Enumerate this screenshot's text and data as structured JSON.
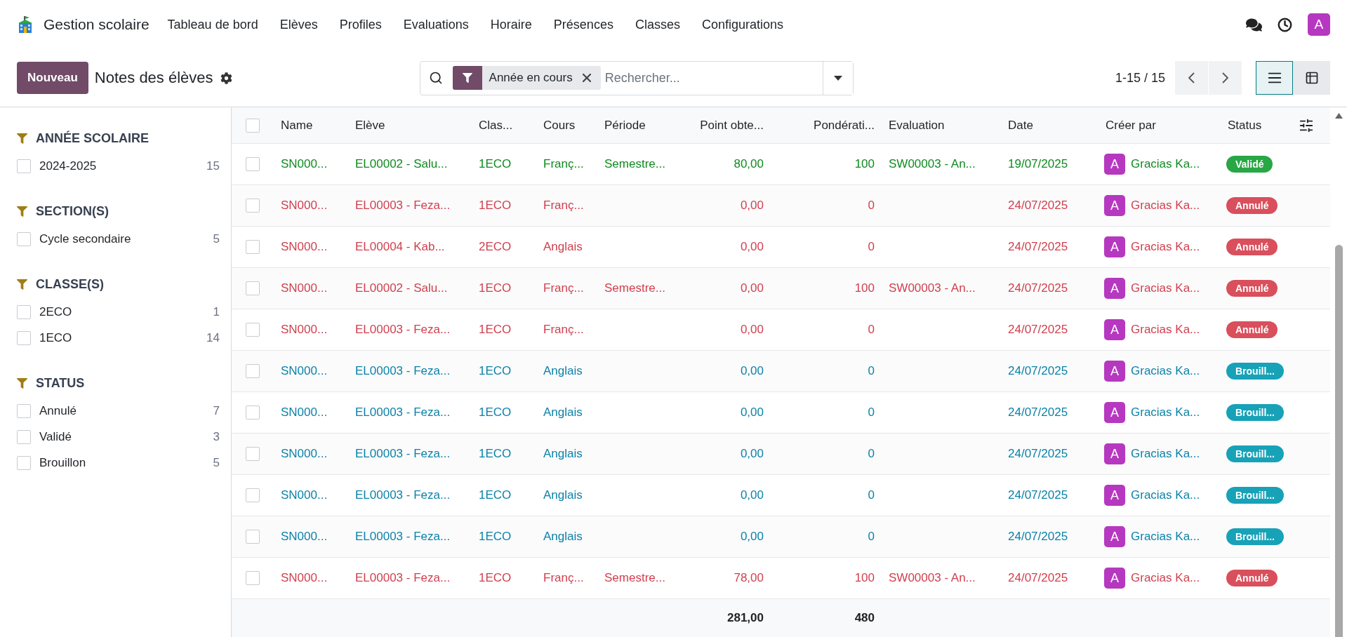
{
  "app": {
    "title": "Gestion scolaire",
    "avatar": "A"
  },
  "menu": [
    "Tableau de bord",
    "Elèves",
    "Profiles",
    "Evaluations",
    "Horaire",
    "Présences",
    "Classes",
    "Configurations"
  ],
  "control_panel": {
    "new_button": "Nouveau",
    "title": "Notes des élèves",
    "facet": "Année en cours",
    "search_placeholder": "Rechercher...",
    "pager": "1-15 / 15",
    "views": [
      {
        "kind": "list",
        "selected": true
      },
      {
        "kind": "pivot",
        "selected": false
      }
    ]
  },
  "sidebar": [
    {
      "title": "ANNÉE SCOLAIRE",
      "items": [
        {
          "label": "2024-2025",
          "count": "15",
          "checked": false
        }
      ]
    },
    {
      "title": "SECTION(S)",
      "items": [
        {
          "label": "Cycle secondaire",
          "count": "5",
          "checked": false
        }
      ]
    },
    {
      "title": "CLASSE(S)",
      "items": [
        {
          "label": "2ECO",
          "count": "1",
          "checked": false
        },
        {
          "label": "1ECO",
          "count": "14",
          "checked": false
        }
      ]
    },
    {
      "title": "STATUS",
      "items": [
        {
          "label": "Annulé",
          "count": "7",
          "checked": false
        },
        {
          "label": "Validé",
          "count": "3",
          "checked": false
        },
        {
          "label": "Brouillon",
          "count": "5",
          "checked": false
        }
      ]
    }
  ],
  "table": {
    "select_all": {
      "checked": false
    },
    "columns": [
      {
        "label": "Name",
        "kind": "text"
      },
      {
        "label": "Elève",
        "kind": "text"
      },
      {
        "label": "Clas...",
        "kind": "text"
      },
      {
        "label": "Cours",
        "kind": "text"
      },
      {
        "label": "Période",
        "kind": "text"
      },
      {
        "label": "Point obte...",
        "kind": "number",
        "total": "281,00"
      },
      {
        "label": "Pondérati...",
        "kind": "number",
        "total": "480"
      },
      {
        "label": "Evaluation",
        "kind": "text"
      },
      {
        "label": "Date",
        "kind": "text"
      },
      {
        "label": "Créer par",
        "kind": "user"
      },
      {
        "label": "Status",
        "kind": "status"
      }
    ],
    "rows": [
      {
        "checked": false,
        "cells": [
          "SN000...",
          "EL00002 - Salu...",
          "1ECO",
          "Franç...",
          "Semestre...",
          "80,00",
          "100",
          "SW00003 - An...",
          "19/07/2025",
          "Gracias Ka..."
        ],
        "avatar": "A",
        "status": {
          "label": "Validé",
          "kind": "validated"
        }
      },
      {
        "checked": false,
        "cells": [
          "SN000...",
          "EL00003 - Feza...",
          "1ECO",
          "Franç...",
          null,
          "0,00",
          "0",
          null,
          "24/07/2025",
          "Gracias Ka..."
        ],
        "avatar": "A",
        "status": {
          "label": "Annulé",
          "kind": "cancelled"
        }
      },
      {
        "checked": false,
        "cells": [
          "SN000...",
          "EL00004 - Kab...",
          "2ECO",
          "Anglais",
          null,
          "0,00",
          "0",
          null,
          "24/07/2025",
          "Gracias Ka..."
        ],
        "avatar": "A",
        "status": {
          "label": "Annulé",
          "kind": "cancelled"
        }
      },
      {
        "checked": false,
        "cells": [
          "SN000...",
          "EL00002 - Salu...",
          "1ECO",
          "Franç...",
          "Semestre...",
          "0,00",
          "100",
          "SW00003 - An...",
          "24/07/2025",
          "Gracias Ka..."
        ],
        "avatar": "A",
        "status": {
          "label": "Annulé",
          "kind": "cancelled"
        }
      },
      {
        "checked": false,
        "cells": [
          "SN000...",
          "EL00003 - Feza...",
          "1ECO",
          "Franç...",
          null,
          "0,00",
          "0",
          null,
          "24/07/2025",
          "Gracias Ka..."
        ],
        "avatar": "A",
        "status": {
          "label": "Annulé",
          "kind": "cancelled"
        }
      },
      {
        "checked": false,
        "cells": [
          "SN000...",
          "EL00003 - Feza...",
          "1ECO",
          "Anglais",
          null,
          "0,00",
          "0",
          null,
          "24/07/2025",
          "Gracias Ka..."
        ],
        "avatar": "A",
        "status": {
          "label": "Brouill...",
          "kind": "draft"
        }
      },
      {
        "checked": false,
        "cells": [
          "SN000...",
          "EL00003 - Feza...",
          "1ECO",
          "Anglais",
          null,
          "0,00",
          "0",
          null,
          "24/07/2025",
          "Gracias Ka..."
        ],
        "avatar": "A",
        "status": {
          "label": "Brouill...",
          "kind": "draft"
        }
      },
      {
        "checked": false,
        "cells": [
          "SN000...",
          "EL00003 - Feza...",
          "1ECO",
          "Anglais",
          null,
          "0,00",
          "0",
          null,
          "24/07/2025",
          "Gracias Ka..."
        ],
        "avatar": "A",
        "status": {
          "label": "Brouill...",
          "kind": "draft"
        }
      },
      {
        "checked": false,
        "cells": [
          "SN000...",
          "EL00003 - Feza...",
          "1ECO",
          "Anglais",
          null,
          "0,00",
          "0",
          null,
          "24/07/2025",
          "Gracias Ka..."
        ],
        "avatar": "A",
        "status": {
          "label": "Brouill...",
          "kind": "draft"
        }
      },
      {
        "checked": false,
        "cells": [
          "SN000...",
          "EL00003 - Feza...",
          "1ECO",
          "Anglais",
          null,
          "0,00",
          "0",
          null,
          "24/07/2025",
          "Gracias Ka..."
        ],
        "avatar": "A",
        "status": {
          "label": "Brouill...",
          "kind": "draft"
        }
      },
      {
        "checked": false,
        "cells": [
          "SN000...",
          "EL00003 - Feza...",
          "1ECO",
          "Franç...",
          "Semestre...",
          "78,00",
          "100",
          "SW00003 - An...",
          "24/07/2025",
          "Gracias Ka..."
        ],
        "avatar": "A",
        "status": {
          "label": "Annulé",
          "kind": "cancelled"
        }
      }
    ]
  }
}
